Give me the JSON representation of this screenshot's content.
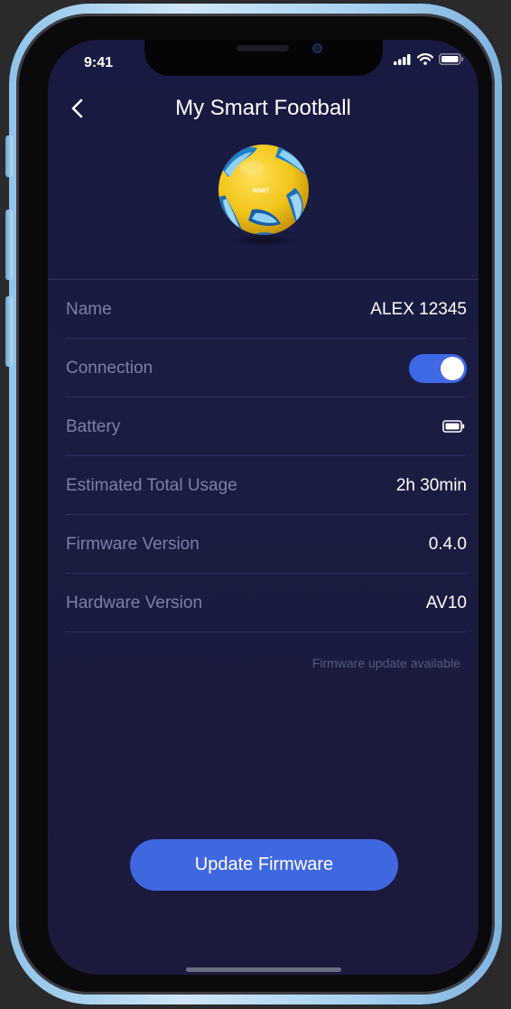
{
  "status_bar": {
    "time": "9:41"
  },
  "header": {
    "title": "My Smart Football",
    "back_icon": "chevron-left-icon"
  },
  "device": {
    "image": "football-image",
    "ball_text": "INSRT"
  },
  "details": [
    {
      "label": "Name",
      "value": "ALEX 12345"
    },
    {
      "label": "Connection",
      "toggle_on": true
    },
    {
      "label": "Battery",
      "icon": "battery-icon"
    },
    {
      "label": "Estimated Total Usage",
      "value": "2h 30min"
    },
    {
      "label": "Firmware Version",
      "value": "0.4.0"
    },
    {
      "label": "Hardware Version",
      "value": "AV10"
    }
  ],
  "update_note": "Firmware update available",
  "update_button": {
    "label": "Update Firmware"
  },
  "colors": {
    "background": "#181a42",
    "accent": "#3f67e0",
    "label": "#7c80a8",
    "note": "#565a80"
  }
}
